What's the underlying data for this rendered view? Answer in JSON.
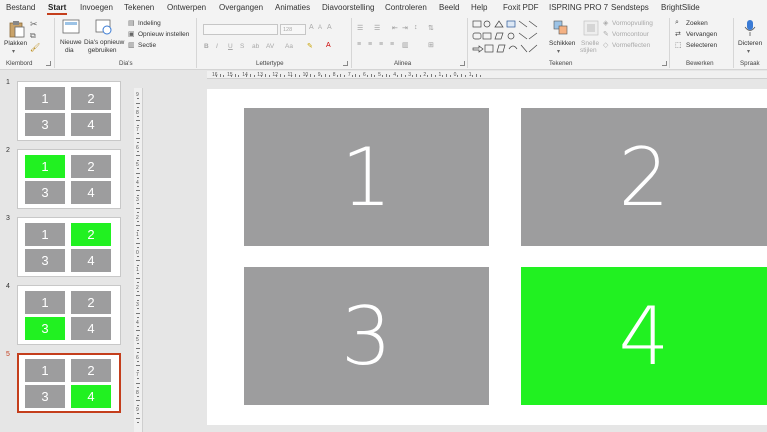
{
  "menu": {
    "tabs": [
      {
        "label": "Bestand",
        "active": false
      },
      {
        "label": "Start",
        "active": true
      },
      {
        "label": "Invoegen",
        "active": false
      },
      {
        "label": "Tekenen",
        "active": false
      },
      {
        "label": "Ontwerpen",
        "active": false
      },
      {
        "label": "Overgangen",
        "active": false
      },
      {
        "label": "Animaties",
        "active": false
      },
      {
        "label": "Diavoorstelling",
        "active": false
      },
      {
        "label": "Controleren",
        "active": false
      },
      {
        "label": "Beeld",
        "active": false
      },
      {
        "label": "Help",
        "active": false
      },
      {
        "label": "Foxit PDF",
        "active": false
      },
      {
        "label": "ISPRING PRO 7",
        "active": false
      },
      {
        "label": "Sendsteps",
        "active": false
      },
      {
        "label": "BrightSlide",
        "active": false
      }
    ],
    "accent_color": "#c43e1c"
  },
  "ribbon": {
    "klembord": {
      "paste_label": "Plakken",
      "group_label": "Klembord"
    },
    "dias": {
      "new_slide_line1": "Nieuwe",
      "new_slide_line2": "dia",
      "reuse_line1": "Dia's opnieuw",
      "reuse_line2": "gebruiken",
      "indeling": "Indeling",
      "opnieuw": "Opnieuw instellen",
      "sectie": "Sectie",
      "group_label": "Dia's"
    },
    "lettertype": {
      "font_size": "128",
      "group_label": "Lettertype",
      "bold": "B",
      "italic": "I",
      "underline": "U",
      "strike": "S",
      "shadow": "ab",
      "spacing": "AV",
      "case": "Aa"
    },
    "alinea": {
      "group_label": "Alinea"
    },
    "tekenen": {
      "schikken_line1": "Schikken",
      "snelle_line1": "Snelle",
      "snelle_line2": "stijlen",
      "vormopvulling": "Vormopvulling",
      "vormcontour": "Vormcontour",
      "vormeffecten": "Vormeffecten",
      "group_label": "Tekenen"
    },
    "bewerken": {
      "zoeken": "Zoeken",
      "vervangen": "Vervangen",
      "selecteren": "Selecteren",
      "group_label": "Bewerken"
    },
    "spraak": {
      "dicteren": "Dicteren",
      "group_label": "Spraak"
    }
  },
  "thumbnails": [
    {
      "num": "1",
      "cells": [
        "1",
        "2",
        "3",
        "4"
      ],
      "green": null,
      "selected": false
    },
    {
      "num": "2",
      "cells": [
        "1",
        "2",
        "3",
        "4"
      ],
      "green": 0,
      "selected": false
    },
    {
      "num": "3",
      "cells": [
        "1",
        "2",
        "3",
        "4"
      ],
      "green": 1,
      "selected": false
    },
    {
      "num": "4",
      "cells": [
        "1",
        "2",
        "3",
        "4"
      ],
      "green": 2,
      "selected": false
    },
    {
      "num": "5",
      "cells": [
        "1",
        "2",
        "3",
        "4"
      ],
      "green": 3,
      "selected": true
    }
  ],
  "ruler": {
    "h_labels": [
      "16",
      "15",
      "14",
      "13",
      "12",
      "11",
      "10",
      "9",
      "8",
      "7",
      "6",
      "5",
      "4",
      "3",
      "2",
      "1",
      "0",
      "1"
    ],
    "v_labels": [
      "9",
      "8",
      "7",
      "6",
      "5",
      "4",
      "3",
      "2",
      "1",
      "0",
      "1",
      "2",
      "3",
      "4",
      "5",
      "6",
      "7",
      "8",
      "9"
    ]
  },
  "slide": {
    "cells": [
      "1",
      "2",
      "3",
      "4"
    ],
    "green_index": 3,
    "cell_color": "#9d9d9e",
    "highlight_color": "#21f121"
  }
}
